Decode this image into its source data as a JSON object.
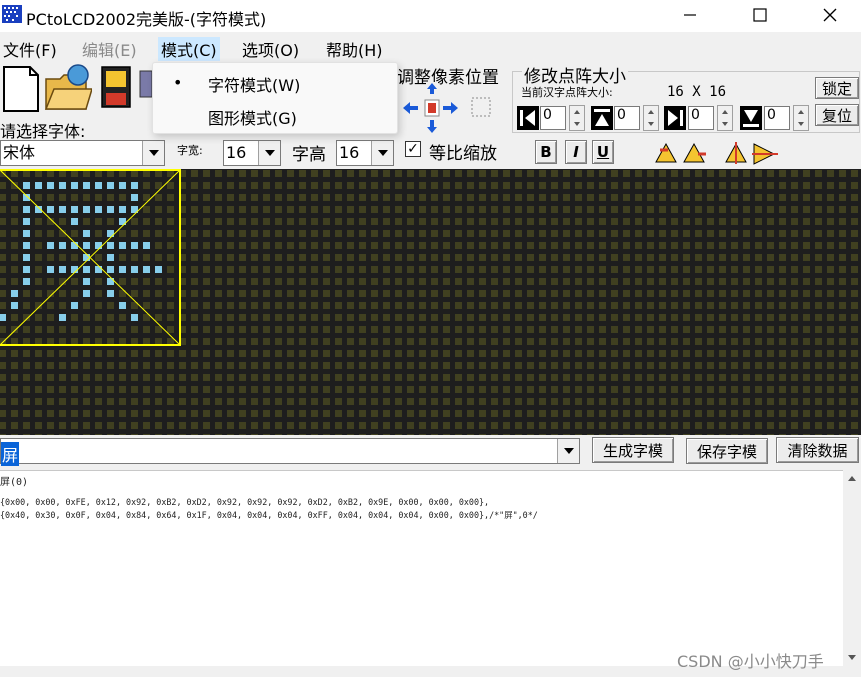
{
  "window": {
    "title": "PCtoLCD2002完美版-(字符模式)",
    "controls": [
      "minimize-icon",
      "maximize-icon",
      "close-icon"
    ]
  },
  "menu": {
    "items": [
      {
        "label": "文件(F)",
        "state": "enabled"
      },
      {
        "label": "编辑(E)",
        "state": "disabled"
      },
      {
        "label": "模式(C)",
        "state": "open"
      },
      {
        "label": "选项(O)",
        "state": "enabled"
      },
      {
        "label": "帮助(H)",
        "state": "enabled"
      }
    ],
    "dropdown": [
      {
        "label": "字符模式(W)",
        "checked": true
      },
      {
        "label": "图形模式(G)",
        "checked": false
      }
    ]
  },
  "toolbar": {
    "adjust_label": "调整像素位置",
    "resize_group_label": "修改点阵大小",
    "current_size_label": "当前汉字点阵大小:",
    "current_size_value": "16 X 16",
    "lock_button": "锁定",
    "reset_button": "复位",
    "spin_values": [
      "0",
      "0",
      "0",
      "0"
    ]
  },
  "font": {
    "select_label": "请选择字体:",
    "font_name": "宋体",
    "width_label": "字宽:",
    "width_value": "16",
    "height_label": "字高",
    "height_value": "16",
    "proportional_label": "等比缩放",
    "proportional_checked": true,
    "format_buttons": [
      "B",
      "I",
      "U"
    ]
  },
  "grid": {
    "cell_color": "#404020",
    "lit_color": "#87ceeb",
    "background": "#1e1e1e",
    "frame_color": "#ffff00",
    "glyph_rows": [
      "0000000000000000",
      "0011111111110000",
      "0010000000010000",
      "0011111111110000",
      "0010001000100000",
      "0010000101000000",
      "0010111111111000",
      "0010000101000000",
      "0010111111111100",
      "0010000101000000",
      "0100000101000000",
      "0100001000100000",
      "1000010000010000",
      "0000000000000000",
      "0000000000000000",
      "0000000000000000"
    ]
  },
  "bottom": {
    "input_char": "屏",
    "generate_button": "生成字模",
    "save_button": "保存字模",
    "clear_button": "清除数据",
    "output_lines": [
      "屏(0)",
      "",
      "{0x00, 0x00, 0xFE, 0x12, 0x92, 0xB2, 0xD2, 0x92, 0x92, 0x92, 0xD2, 0xB2, 0x9E, 0x00, 0x00, 0x00},",
      "{0x40, 0x30, 0x0F, 0x04, 0x84, 0x64, 0x1F, 0x04, 0x04, 0x04, 0xFF, 0x04, 0x04, 0x04, 0x00, 0x00},/*\"屏\",0*/"
    ]
  },
  "watermark": "CSDN @小小快刀手"
}
